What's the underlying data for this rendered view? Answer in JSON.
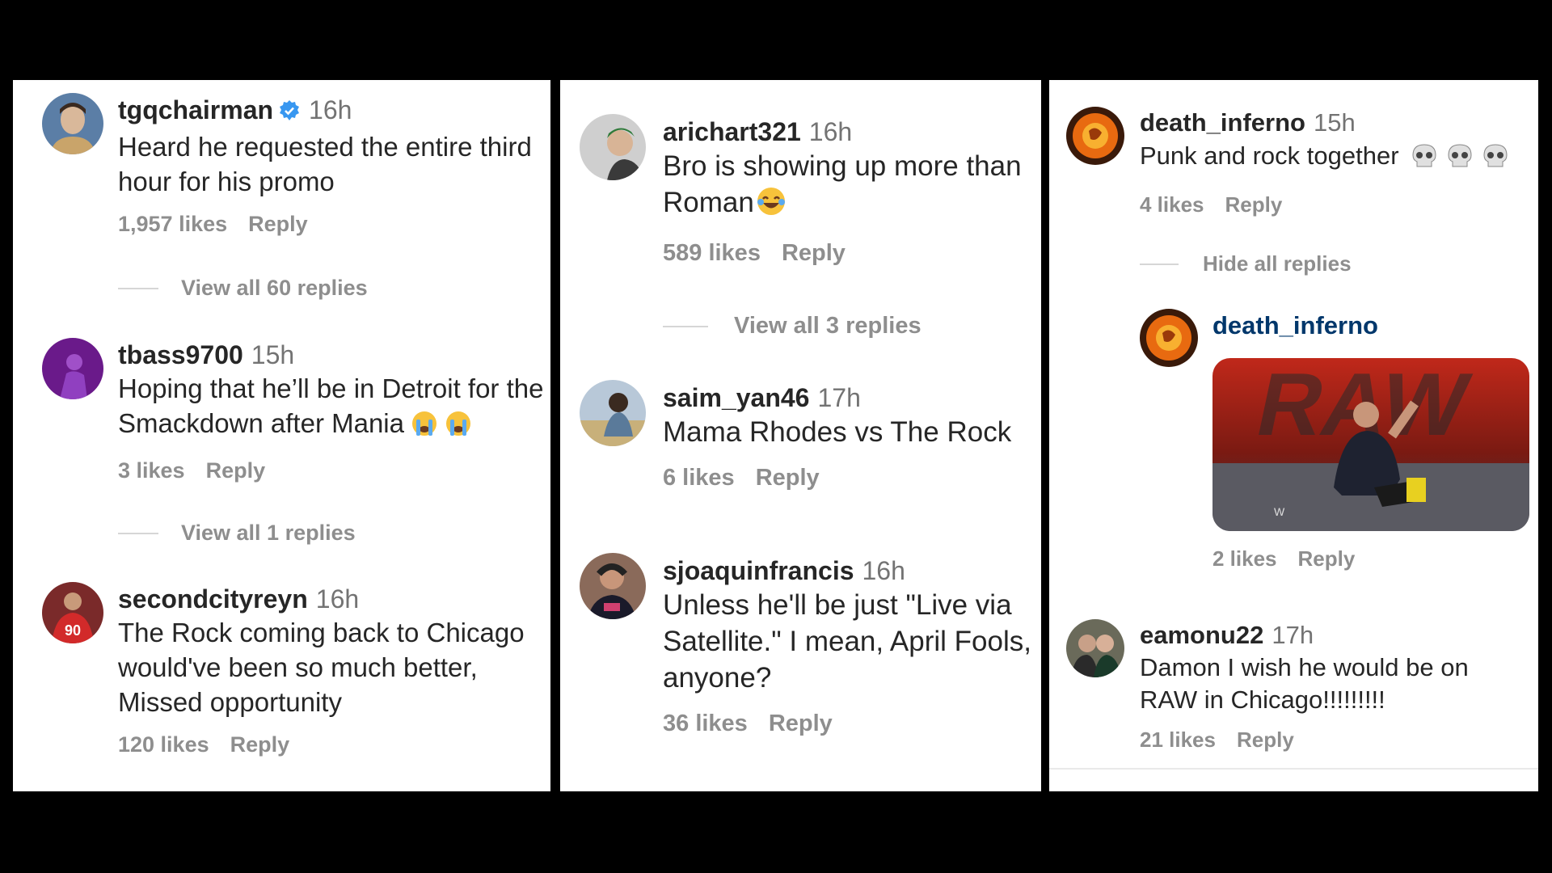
{
  "panel1": {
    "comments": [
      {
        "user": "tgqchairman",
        "time": "16h",
        "text": "Heard he requested the entire third hour for his promo",
        "likes": "1,957 likes",
        "reply": "Reply",
        "verified": true,
        "view_replies": "View all 60 replies"
      },
      {
        "user": "tbass9700",
        "time": "15h",
        "text": "Hoping that he’ll be in Detroit for the Smackdown after Mania",
        "likes": "3 likes",
        "reply": "Reply",
        "view_replies": "View all 1 replies"
      },
      {
        "user": "secondcityreyn",
        "time": "16h",
        "text": "The Rock coming back to Chicago would've been so much better, Missed opportunity",
        "likes": "120 likes",
        "reply": "Reply",
        "jersey": "90"
      }
    ]
  },
  "panel2": {
    "comments": [
      {
        "user": "arichart321",
        "time": "16h",
        "text": "Bro is showing up more than Roman",
        "likes": "589 likes",
        "reply": "Reply",
        "view_replies": "View all 3 replies"
      },
      {
        "user": "saim_yan46",
        "time": "17h",
        "text": "Mama Rhodes vs The Rock",
        "likes": "6 likes",
        "reply": "Reply"
      },
      {
        "user": "sjoaquinfrancis",
        "time": "16h",
        "text": "Unless he'll be just \"Live via Satellite.\" I mean, April Fools, anyone?",
        "likes": "36 likes",
        "reply": "Reply"
      }
    ]
  },
  "panel3": {
    "comments": [
      {
        "user": "death_inferno",
        "time": "15h",
        "text": "Punk and rock together",
        "likes": "4 likes",
        "reply": "Reply",
        "hide_replies": "Hide all replies"
      },
      {
        "user": "death_inferno",
        "likes": "2 likes",
        "reply": "Reply",
        "gif_brand": "RAW",
        "gif_logo": "W"
      },
      {
        "user": "eamonu22",
        "time": "17h",
        "text": "Damon I wish he would be on RAW in Chicago!!!!!!!!!",
        "likes": "21 likes",
        "reply": "Reply"
      }
    ]
  },
  "icons": [
    "verified-badge-icon",
    "crying-face-icon",
    "laughing-face-icon",
    "skull-icon"
  ],
  "colors": {
    "verified": "#3897f0",
    "link": "#00376b",
    "muted": "#737373",
    "text": "#262626"
  }
}
